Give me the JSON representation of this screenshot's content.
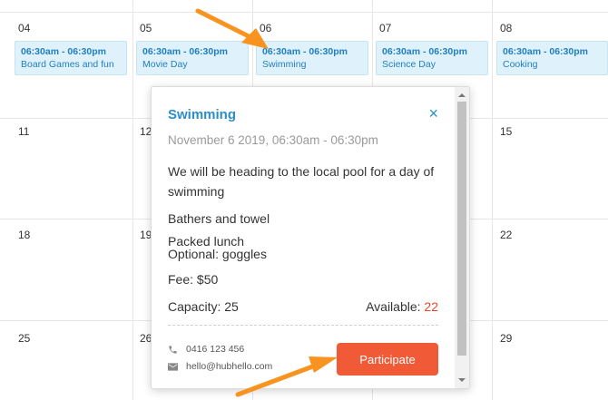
{
  "calendar": {
    "days": {
      "d04": "04",
      "d05": "05",
      "d06": "06",
      "d07": "07",
      "d08": "08",
      "d11": "11",
      "d12": "12",
      "d15": "15",
      "d18": "18",
      "d19": "19",
      "d22": "22",
      "d25": "25",
      "d26": "26",
      "d29": "29"
    },
    "events": [
      {
        "time": "06:30am - 06:30pm",
        "name": "Board Games and fun"
      },
      {
        "time": "06:30am - 06:30pm",
        "name": "Movie Day"
      },
      {
        "time": "06:30am - 06:30pm",
        "name": "Swimming"
      },
      {
        "time": "06:30am - 06:30pm",
        "name": "Science Day"
      },
      {
        "time": "06:30am - 06:30pm",
        "name": "Cooking"
      }
    ]
  },
  "popup": {
    "title": "Swimming",
    "close_glyph": "×",
    "date": "November 6 2019, 06:30am - 06:30pm",
    "description": "We will be heading to the local pool for a day of swimming",
    "item1": "Bathers and towel",
    "item2": "Packed lunch",
    "item3": "Optional: goggles",
    "fee": "Fee: $50",
    "capacity": "Capacity: 25",
    "available_label": "Available: ",
    "available_value": "22",
    "phone": "0416 123 456",
    "email": "hello@hubhello.com",
    "participate_label": "Participate"
  },
  "colors": {
    "accent": "#2a8fc7",
    "button": "#f15a36",
    "arrow": "#f7931e",
    "event_bg": "#dff1fb"
  }
}
